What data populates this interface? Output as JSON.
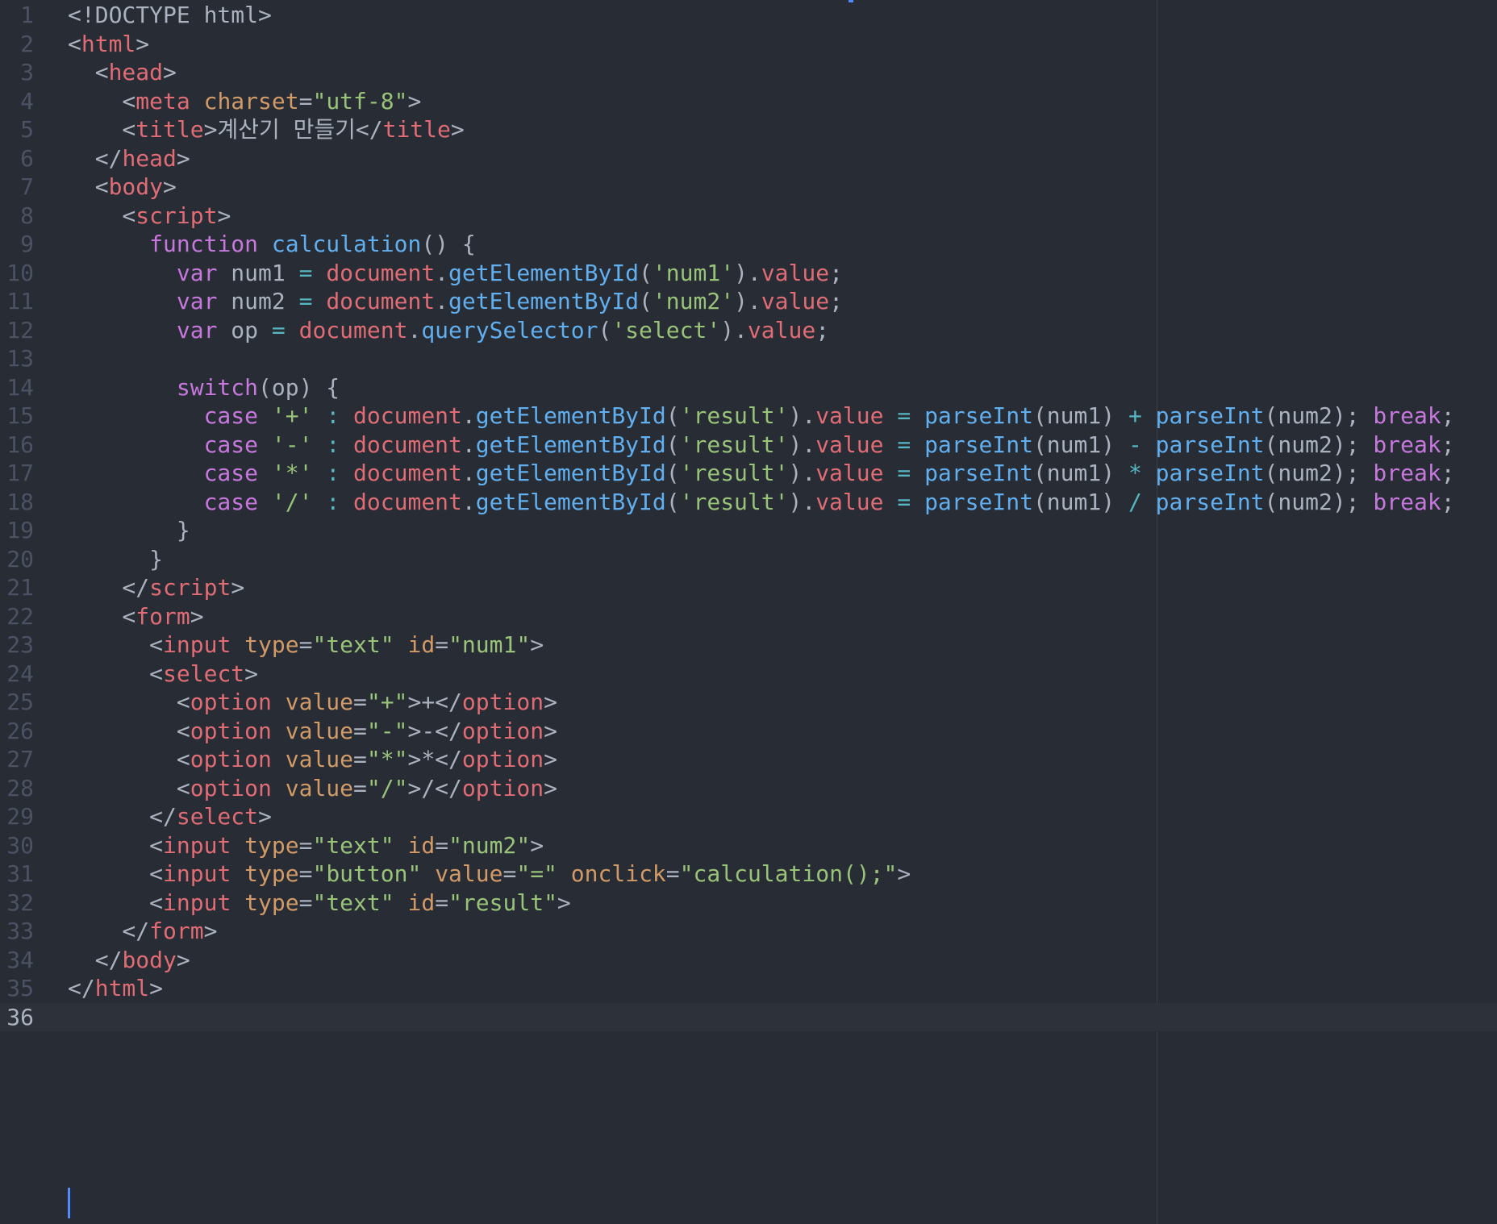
{
  "editor": {
    "theme_colors": {
      "background": "#282c34",
      "active_line": "#2c313a",
      "gutter_text": "#4b5263",
      "plain": "#abb2bf",
      "tag": "#e06c75",
      "attribute": "#d19a66",
      "string": "#98c379",
      "keyword": "#c678dd",
      "function": "#61afef",
      "operator": "#56b6c2",
      "cursor": "#528bff"
    },
    "active_line": 36,
    "lines": [
      {
        "n": "1",
        "tokens": [
          [
            "p",
            "<!DOCTYPE html>"
          ]
        ]
      },
      {
        "n": "2",
        "tokens": [
          [
            "p",
            "<"
          ],
          [
            "t",
            "html"
          ],
          [
            "p",
            ">"
          ]
        ]
      },
      {
        "n": "3",
        "tokens": [
          [
            "p",
            "  <"
          ],
          [
            "t",
            "head"
          ],
          [
            "p",
            ">"
          ]
        ]
      },
      {
        "n": "4",
        "tokens": [
          [
            "p",
            "    <"
          ],
          [
            "t",
            "meta"
          ],
          [
            "p",
            " "
          ],
          [
            "a",
            "charset"
          ],
          [
            "p",
            "="
          ],
          [
            "s",
            "\"utf-8\""
          ],
          [
            "p",
            ">"
          ]
        ]
      },
      {
        "n": "5",
        "tokens": [
          [
            "p",
            "    <"
          ],
          [
            "t",
            "title"
          ],
          [
            "p",
            ">계산기 만들기</"
          ],
          [
            "t",
            "title"
          ],
          [
            "p",
            ">"
          ]
        ]
      },
      {
        "n": "6",
        "tokens": [
          [
            "p",
            "  </"
          ],
          [
            "t",
            "head"
          ],
          [
            "p",
            ">"
          ]
        ]
      },
      {
        "n": "7",
        "tokens": [
          [
            "p",
            "  <"
          ],
          [
            "t",
            "body"
          ],
          [
            "p",
            ">"
          ]
        ]
      },
      {
        "n": "8",
        "tokens": [
          [
            "p",
            "    <"
          ],
          [
            "t",
            "script"
          ],
          [
            "p",
            ">"
          ]
        ]
      },
      {
        "n": "9",
        "tokens": [
          [
            "p",
            "      "
          ],
          [
            "k",
            "function"
          ],
          [
            "p",
            " "
          ],
          [
            "f",
            "calculation"
          ],
          [
            "p",
            "() {"
          ]
        ]
      },
      {
        "n": "10",
        "tokens": [
          [
            "p",
            "        "
          ],
          [
            "k",
            "var"
          ],
          [
            "p",
            " num1 "
          ],
          [
            "o",
            "="
          ],
          [
            "p",
            " "
          ],
          [
            "r",
            "document"
          ],
          [
            "p",
            "."
          ],
          [
            "f",
            "getElementById"
          ],
          [
            "p",
            "("
          ],
          [
            "s",
            "'num1'"
          ],
          [
            "p",
            ")."
          ],
          [
            "r",
            "value"
          ],
          [
            "p",
            ";"
          ]
        ]
      },
      {
        "n": "11",
        "tokens": [
          [
            "p",
            "        "
          ],
          [
            "k",
            "var"
          ],
          [
            "p",
            " num2 "
          ],
          [
            "o",
            "="
          ],
          [
            "p",
            " "
          ],
          [
            "r",
            "document"
          ],
          [
            "p",
            "."
          ],
          [
            "f",
            "getElementById"
          ],
          [
            "p",
            "("
          ],
          [
            "s",
            "'num2'"
          ],
          [
            "p",
            ")."
          ],
          [
            "r",
            "value"
          ],
          [
            "p",
            ";"
          ]
        ]
      },
      {
        "n": "12",
        "tokens": [
          [
            "p",
            "        "
          ],
          [
            "k",
            "var"
          ],
          [
            "p",
            " op "
          ],
          [
            "o",
            "="
          ],
          [
            "p",
            " "
          ],
          [
            "r",
            "document"
          ],
          [
            "p",
            "."
          ],
          [
            "f",
            "querySelector"
          ],
          [
            "p",
            "("
          ],
          [
            "s",
            "'select'"
          ],
          [
            "p",
            ")."
          ],
          [
            "r",
            "value"
          ],
          [
            "p",
            ";"
          ]
        ]
      },
      {
        "n": "13",
        "tokens": []
      },
      {
        "n": "14",
        "tokens": [
          [
            "p",
            "        "
          ],
          [
            "k",
            "switch"
          ],
          [
            "p",
            "(op) {"
          ]
        ]
      },
      {
        "n": "15",
        "tokens": [
          [
            "p",
            "          "
          ],
          [
            "k",
            "case"
          ],
          [
            "p",
            " "
          ],
          [
            "s",
            "'+'"
          ],
          [
            "p",
            " "
          ],
          [
            "o",
            ":"
          ],
          [
            "p",
            " "
          ],
          [
            "r",
            "document"
          ],
          [
            "p",
            "."
          ],
          [
            "f",
            "getElementById"
          ],
          [
            "p",
            "("
          ],
          [
            "s",
            "'result'"
          ],
          [
            "p",
            ")."
          ],
          [
            "r",
            "value"
          ],
          [
            "p",
            " "
          ],
          [
            "o",
            "="
          ],
          [
            "p",
            " "
          ],
          [
            "f",
            "parseInt"
          ],
          [
            "p",
            "(num1) "
          ],
          [
            "o",
            "+"
          ],
          [
            "p",
            " "
          ],
          [
            "f",
            "parseInt"
          ],
          [
            "p",
            "(num2); "
          ],
          [
            "k",
            "break"
          ],
          [
            "p",
            ";"
          ]
        ]
      },
      {
        "n": "16",
        "tokens": [
          [
            "p",
            "          "
          ],
          [
            "k",
            "case"
          ],
          [
            "p",
            " "
          ],
          [
            "s",
            "'-'"
          ],
          [
            "p",
            " "
          ],
          [
            "o",
            ":"
          ],
          [
            "p",
            " "
          ],
          [
            "r",
            "document"
          ],
          [
            "p",
            "."
          ],
          [
            "f",
            "getElementById"
          ],
          [
            "p",
            "("
          ],
          [
            "s",
            "'result'"
          ],
          [
            "p",
            ")."
          ],
          [
            "r",
            "value"
          ],
          [
            "p",
            " "
          ],
          [
            "o",
            "="
          ],
          [
            "p",
            " "
          ],
          [
            "f",
            "parseInt"
          ],
          [
            "p",
            "(num1) "
          ],
          [
            "o",
            "-"
          ],
          [
            "p",
            " "
          ],
          [
            "f",
            "parseInt"
          ],
          [
            "p",
            "(num2); "
          ],
          [
            "k",
            "break"
          ],
          [
            "p",
            ";"
          ]
        ]
      },
      {
        "n": "17",
        "tokens": [
          [
            "p",
            "          "
          ],
          [
            "k",
            "case"
          ],
          [
            "p",
            " "
          ],
          [
            "s",
            "'*'"
          ],
          [
            "p",
            " "
          ],
          [
            "o",
            ":"
          ],
          [
            "p",
            " "
          ],
          [
            "r",
            "document"
          ],
          [
            "p",
            "."
          ],
          [
            "f",
            "getElementById"
          ],
          [
            "p",
            "("
          ],
          [
            "s",
            "'result'"
          ],
          [
            "p",
            ")."
          ],
          [
            "r",
            "value"
          ],
          [
            "p",
            " "
          ],
          [
            "o",
            "="
          ],
          [
            "p",
            " "
          ],
          [
            "f",
            "parseInt"
          ],
          [
            "p",
            "(num1) "
          ],
          [
            "o",
            "*"
          ],
          [
            "p",
            " "
          ],
          [
            "f",
            "parseInt"
          ],
          [
            "p",
            "(num2); "
          ],
          [
            "k",
            "break"
          ],
          [
            "p",
            ";"
          ]
        ]
      },
      {
        "n": "18",
        "tokens": [
          [
            "p",
            "          "
          ],
          [
            "k",
            "case"
          ],
          [
            "p",
            " "
          ],
          [
            "s",
            "'/'"
          ],
          [
            "p",
            " "
          ],
          [
            "o",
            ":"
          ],
          [
            "p",
            " "
          ],
          [
            "r",
            "document"
          ],
          [
            "p",
            "."
          ],
          [
            "f",
            "getElementById"
          ],
          [
            "p",
            "("
          ],
          [
            "s",
            "'result'"
          ],
          [
            "p",
            ")."
          ],
          [
            "r",
            "value"
          ],
          [
            "p",
            " "
          ],
          [
            "o",
            "="
          ],
          [
            "p",
            " "
          ],
          [
            "f",
            "parseInt"
          ],
          [
            "p",
            "(num1) "
          ],
          [
            "o",
            "/"
          ],
          [
            "p",
            " "
          ],
          [
            "f",
            "parseInt"
          ],
          [
            "p",
            "(num2); "
          ],
          [
            "k",
            "break"
          ],
          [
            "p",
            ";"
          ]
        ]
      },
      {
        "n": "19",
        "tokens": [
          [
            "p",
            "        }"
          ]
        ]
      },
      {
        "n": "20",
        "tokens": [
          [
            "p",
            "      }"
          ]
        ]
      },
      {
        "n": "21",
        "tokens": [
          [
            "p",
            "    </"
          ],
          [
            "t",
            "script"
          ],
          [
            "p",
            ">"
          ]
        ]
      },
      {
        "n": "22",
        "tokens": [
          [
            "p",
            "    <"
          ],
          [
            "t",
            "form"
          ],
          [
            "p",
            ">"
          ]
        ]
      },
      {
        "n": "23",
        "tokens": [
          [
            "p",
            "      <"
          ],
          [
            "t",
            "input"
          ],
          [
            "p",
            " "
          ],
          [
            "a",
            "type"
          ],
          [
            "p",
            "="
          ],
          [
            "s",
            "\"text\""
          ],
          [
            "p",
            " "
          ],
          [
            "a",
            "id"
          ],
          [
            "p",
            "="
          ],
          [
            "s",
            "\"num1\""
          ],
          [
            "p",
            ">"
          ]
        ]
      },
      {
        "n": "24",
        "tokens": [
          [
            "p",
            "      <"
          ],
          [
            "t",
            "select"
          ],
          [
            "p",
            ">"
          ]
        ]
      },
      {
        "n": "25",
        "tokens": [
          [
            "p",
            "        <"
          ],
          [
            "t",
            "option"
          ],
          [
            "p",
            " "
          ],
          [
            "a",
            "value"
          ],
          [
            "p",
            "="
          ],
          [
            "s",
            "\"+\""
          ],
          [
            "p",
            ">+</"
          ],
          [
            "t",
            "option"
          ],
          [
            "p",
            ">"
          ]
        ]
      },
      {
        "n": "26",
        "tokens": [
          [
            "p",
            "        <"
          ],
          [
            "t",
            "option"
          ],
          [
            "p",
            " "
          ],
          [
            "a",
            "value"
          ],
          [
            "p",
            "="
          ],
          [
            "s",
            "\"-\""
          ],
          [
            "p",
            ">-</"
          ],
          [
            "t",
            "option"
          ],
          [
            "p",
            ">"
          ]
        ]
      },
      {
        "n": "27",
        "tokens": [
          [
            "p",
            "        <"
          ],
          [
            "t",
            "option"
          ],
          [
            "p",
            " "
          ],
          [
            "a",
            "value"
          ],
          [
            "p",
            "="
          ],
          [
            "s",
            "\"*\""
          ],
          [
            "p",
            ">*</"
          ],
          [
            "t",
            "option"
          ],
          [
            "p",
            ">"
          ]
        ]
      },
      {
        "n": "28",
        "tokens": [
          [
            "p",
            "        <"
          ],
          [
            "t",
            "option"
          ],
          [
            "p",
            " "
          ],
          [
            "a",
            "value"
          ],
          [
            "p",
            "="
          ],
          [
            "s",
            "\"/\""
          ],
          [
            "p",
            ">/</"
          ],
          [
            "t",
            "option"
          ],
          [
            "p",
            ">"
          ]
        ]
      },
      {
        "n": "29",
        "tokens": [
          [
            "p",
            "      </"
          ],
          [
            "t",
            "select"
          ],
          [
            "p",
            ">"
          ]
        ]
      },
      {
        "n": "30",
        "tokens": [
          [
            "p",
            "      <"
          ],
          [
            "t",
            "input"
          ],
          [
            "p",
            " "
          ],
          [
            "a",
            "type"
          ],
          [
            "p",
            "="
          ],
          [
            "s",
            "\"text\""
          ],
          [
            "p",
            " "
          ],
          [
            "a",
            "id"
          ],
          [
            "p",
            "="
          ],
          [
            "s",
            "\"num2\""
          ],
          [
            "p",
            ">"
          ]
        ]
      },
      {
        "n": "31",
        "tokens": [
          [
            "p",
            "      <"
          ],
          [
            "t",
            "input"
          ],
          [
            "p",
            " "
          ],
          [
            "a",
            "type"
          ],
          [
            "p",
            "="
          ],
          [
            "s",
            "\"button\""
          ],
          [
            "p",
            " "
          ],
          [
            "a",
            "value"
          ],
          [
            "p",
            "="
          ],
          [
            "s",
            "\"=\""
          ],
          [
            "p",
            " "
          ],
          [
            "a",
            "onclick"
          ],
          [
            "p",
            "="
          ],
          [
            "s",
            "\"calculation();\""
          ],
          [
            "p",
            ">"
          ]
        ]
      },
      {
        "n": "32",
        "tokens": [
          [
            "p",
            "      <"
          ],
          [
            "t",
            "input"
          ],
          [
            "p",
            " "
          ],
          [
            "a",
            "type"
          ],
          [
            "p",
            "="
          ],
          [
            "s",
            "\"text\""
          ],
          [
            "p",
            " "
          ],
          [
            "a",
            "id"
          ],
          [
            "p",
            "="
          ],
          [
            "s",
            "\"result\""
          ],
          [
            "p",
            ">"
          ]
        ]
      },
      {
        "n": "33",
        "tokens": [
          [
            "p",
            "    </"
          ],
          [
            "t",
            "form"
          ],
          [
            "p",
            ">"
          ]
        ]
      },
      {
        "n": "34",
        "tokens": [
          [
            "p",
            "  </"
          ],
          [
            "t",
            "body"
          ],
          [
            "p",
            ">"
          ]
        ]
      },
      {
        "n": "35",
        "tokens": [
          [
            "p",
            "</"
          ],
          [
            "t",
            "html"
          ],
          [
            "p",
            ">"
          ]
        ]
      },
      {
        "n": "36",
        "tokens": []
      }
    ]
  }
}
